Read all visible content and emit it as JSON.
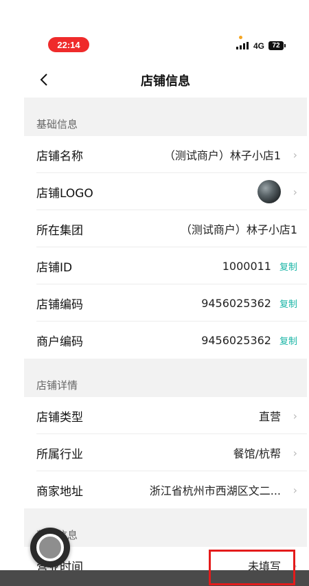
{
  "status_bar": {
    "time": "22:14",
    "network": "4G",
    "battery": "72"
  },
  "nav": {
    "title": "店铺信息"
  },
  "sections": {
    "basic": {
      "header": "基础信息",
      "rows": {
        "store_name": {
          "label": "店铺名称",
          "value": "（测试商户）林子小店1"
        },
        "store_logo": {
          "label": "店铺LOGO"
        },
        "group": {
          "label": "所在集团",
          "value": "（测试商户）林子小店1"
        },
        "store_id": {
          "label": "店铺ID",
          "value": "1000011",
          "action": "复制"
        },
        "store_code": {
          "label": "店铺编码",
          "value": "9456025362",
          "action": "复制"
        },
        "merchant_code": {
          "label": "商户编码",
          "value": "9456025362",
          "action": "复制"
        }
      }
    },
    "detail": {
      "header": "店铺详情",
      "rows": {
        "store_type": {
          "label": "店铺类型",
          "value": "直营"
        },
        "industry": {
          "label": "所属行业",
          "value": "餐馆/杭帮"
        },
        "address": {
          "label": "商家地址",
          "value": "浙江省杭州市西湖区文二..."
        }
      }
    },
    "operation": {
      "header": "营业信息",
      "rows": {
        "hours": {
          "label": "营业时间",
          "value": "未填写"
        }
      }
    }
  },
  "colors": {
    "accent_copy": "#19b5a6",
    "time_pill": "#ef2b2b",
    "highlight": "#e41b1b"
  }
}
